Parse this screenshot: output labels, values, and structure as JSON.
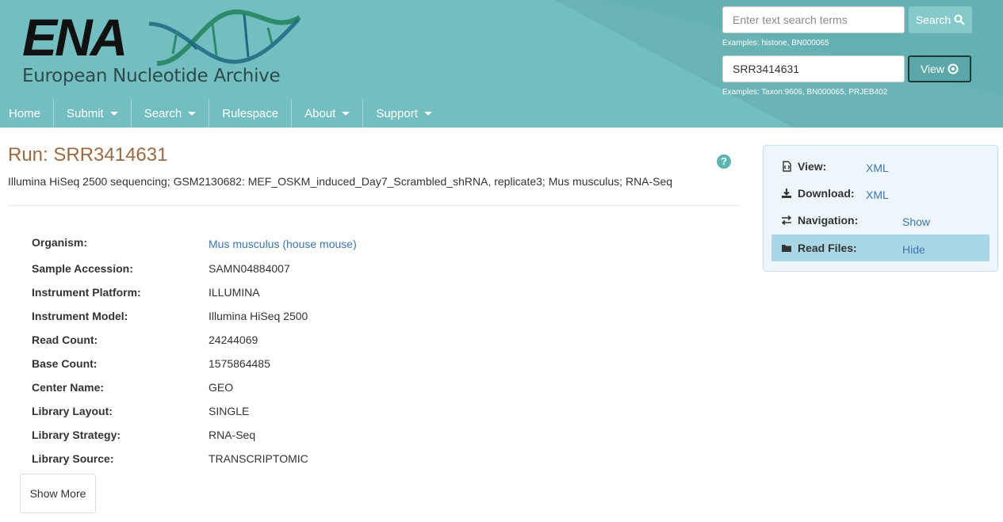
{
  "header": {
    "logo_text": "ENA",
    "logo_subtitle": "European Nucleotide Archive",
    "search": {
      "placeholder": "Enter text search terms",
      "button_label": "Search",
      "examples": "Examples: histone, BN000065"
    },
    "view": {
      "value": "SRR3414631",
      "button_label": "View",
      "examples": "Examples: Taxon:9606, BN000065, PRJEB402"
    }
  },
  "nav": {
    "items": [
      {
        "label": "Home",
        "dropdown": false
      },
      {
        "label": "Submit",
        "dropdown": true
      },
      {
        "label": "Search",
        "dropdown": true
      },
      {
        "label": "Rulespace",
        "dropdown": false
      },
      {
        "label": "About",
        "dropdown": true
      },
      {
        "label": "Support",
        "dropdown": true
      }
    ]
  },
  "main": {
    "title": "Run: SRR3414631",
    "description": "Illumina HiSeq 2500 sequencing; GSM2130682: MEF_OSKM_induced_Day7_Scrambled_shRNA, replicate3; Mus musculus; RNA-Seq",
    "help_icon": "question-circle-icon",
    "attributes": [
      {
        "label": "Organism:",
        "value": "Mus musculus (house mouse)",
        "link": true
      },
      {
        "label": "Sample Accession:",
        "value": "SAMN04884007",
        "link": false
      },
      {
        "label": "Instrument Platform:",
        "value": "ILLUMINA",
        "link": false
      },
      {
        "label": "Instrument Model:",
        "value": "Illumina HiSeq 2500",
        "link": false
      },
      {
        "label": "Read Count:",
        "value": "24244069",
        "link": false
      },
      {
        "label": "Base Count:",
        "value": "1575864485",
        "link": false
      },
      {
        "label": "Center Name:",
        "value": "GEO",
        "link": false
      },
      {
        "label": "Library Layout:",
        "value": "SINGLE",
        "link": false
      },
      {
        "label": "Library Strategy:",
        "value": "RNA-Seq",
        "link": false
      },
      {
        "label": "Library Source:",
        "value": "TRANSCRIPTOMIC",
        "link": false
      }
    ],
    "show_more_label": "Show More"
  },
  "side_panel": {
    "rows": [
      {
        "icon": "file-code-icon",
        "label": "View:",
        "link": "XML"
      },
      {
        "icon": "download-icon",
        "label": "Download:",
        "link": "XML"
      },
      {
        "icon": "exchange-icon",
        "label": "Navigation:",
        "link": "Show"
      },
      {
        "icon": "folder-icon",
        "label": "Read Files:",
        "link": "Hide"
      }
    ]
  },
  "colors": {
    "header_bg": "#72bec0",
    "title": "#9a6a40",
    "link": "#3a75b0",
    "panel_bg": "#edf6fb",
    "panel_active": "#a9d7e6"
  }
}
